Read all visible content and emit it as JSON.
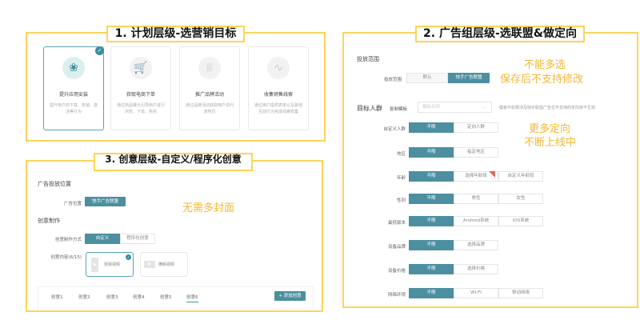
{
  "plan": {
    "title": "1. 计划层级-选营销目标",
    "cards": [
      {
        "icon": "app-grid-icon",
        "title": "提升应用安装",
        "desc": "提升用户的下载、安装、激活等行为",
        "selected": true
      },
      {
        "icon": "cart-icon",
        "title": "获取电商下单",
        "desc": "通过商品曝光引导用户进行浏览、下单、购买",
        "selected": false
      },
      {
        "icon": "crown-icon",
        "title": "推广品牌活动",
        "desc": "通过品牌活动获取用户访问落地页",
        "selected": false
      },
      {
        "icon": "path-icon",
        "title": "收集销售线索",
        "desc": "通过用户提供表单以及其他互动行为完成线索收集",
        "selected": false
      }
    ]
  },
  "adgroup": {
    "title": "2. 广告组层级-选联盟&做定向",
    "scope_heading": "投放范围",
    "scope_label": "投放范围",
    "scope_options": [
      "默认",
      "快手广告联盟"
    ],
    "scope_selected": 1,
    "note1": "不能多选",
    "note2": "保存后不支持修改",
    "audience_heading": "目标人群",
    "copy_template": "复制模板",
    "template_placeholder": "模板名称",
    "template_hint": "模板中如果涉及快手联盟广告位不支持的定向将不生效",
    "note3": "更多定向",
    "note4": "不断上线中",
    "rows": [
      {
        "label": "自定义人群",
        "options": [
          "不限",
          "定向人群"
        ]
      },
      {
        "label": "地区",
        "options": [
          "不限",
          "指定地区"
        ]
      },
      {
        "label": "年龄",
        "options": [
          "不限",
          "选择年龄段",
          "自定义年龄段"
        ]
      },
      {
        "label": "性别",
        "options": [
          "不限",
          "男性",
          "女性"
        ]
      },
      {
        "label": "最低版本",
        "options": [
          "不限",
          "Android系统",
          "IOS系统"
        ]
      },
      {
        "label": "设备品牌",
        "options": [
          "不限",
          "选择品牌"
        ]
      },
      {
        "label": "设备价格",
        "options": [
          "不限",
          "选择价格"
        ]
      },
      {
        "label": "网络环境",
        "options": [
          "不限",
          "WI-FI",
          "移动网络"
        ]
      }
    ]
  },
  "creative": {
    "title": "3. 创意层级-自定义/程序化创意",
    "placement_heading": "广告投放位置",
    "placement_label": "广告位置",
    "placement_value": "快手广告联盟",
    "note": "无需多封面",
    "make_heading": "创意制作",
    "method_label": "创意制作方式",
    "methods": [
      "自定义",
      "程序化创意"
    ],
    "content_label": "创意内容(6/15)",
    "content_types": [
      "竖版视频",
      "横版视频"
    ],
    "tabs": [
      "创意1",
      "创意2",
      "创意3",
      "创意4",
      "创意5",
      "创意6"
    ],
    "active_tab": 5,
    "add_button": "+ 添加创意"
  },
  "colors": {
    "accent": "#4c8fa0",
    "highlight": "#fdd45a",
    "note": "#f5b730"
  }
}
